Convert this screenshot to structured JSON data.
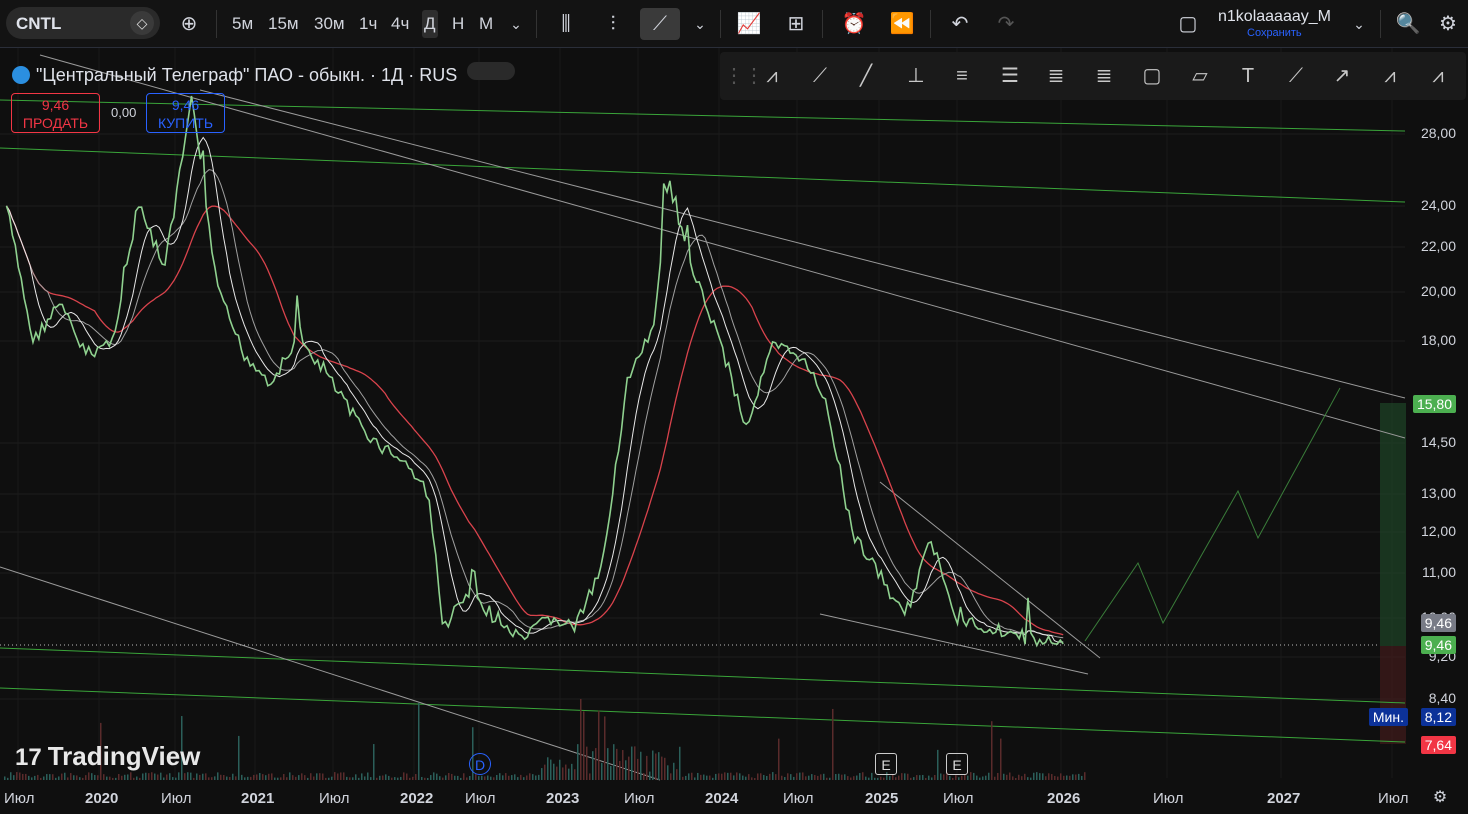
{
  "toolbar": {
    "symbol": "CNTL",
    "timeframes": [
      "5м",
      "15м",
      "30м",
      "1ч",
      "4ч",
      "Д",
      "Н",
      "М"
    ],
    "active_timeframe": "Д",
    "user": "n1kolaaaaay_M",
    "save_label": "Сохранить"
  },
  "legend": {
    "title": "\"Центральный Телеграф\" ПАО - обыкн. · 1Д · RUS"
  },
  "trade": {
    "sell_price": "9,46",
    "sell_label": "ПРОДАТЬ",
    "spread": "0,00",
    "buy_price": "9,46",
    "buy_label": "КУПИТЬ"
  },
  "watermark": "TradingView",
  "price_tags": {
    "target": "15,80",
    "last_gray": "9,46",
    "last_green": "9,46",
    "min_label": "Мин.",
    "min_value": "8,12",
    "stop": "7,64"
  },
  "events": [
    "D",
    "E",
    "E"
  ],
  "colors": {
    "price": "#8fd18f",
    "sma_slow": "#d9434c",
    "sma_fast": "#ffffff",
    "green_line": "#3aa53a",
    "target_zone": "#1f4d2a",
    "stop_zone": "#4a1c1c"
  },
  "chart_data": {
    "type": "line",
    "series": [
      {
        "x": [
          "2019-06",
          "2019-08",
          "2019-10",
          "2019-12",
          "2020-02",
          "2020-04",
          "2020-06",
          "2020-08",
          "2020-10",
          "2020-12",
          "2021-02",
          "2021-04",
          "2021-06",
          "2021-08",
          "2021-10",
          "2021-12",
          "2022-02",
          "2022-03",
          "2022-05",
          "2022-07",
          "2022-09",
          "2022-11",
          "2023-01",
          "2023-03",
          "2023-05",
          "2023-07",
          "2023-08",
          "2023-10",
          "2023-12",
          "2024-02",
          "2024-04",
          "2024-06",
          "2024-08",
          "2024-10",
          "2024-12",
          "2025-02",
          "2025-04",
          "2025-06",
          "2025-08",
          "2025-10",
          "2025-12",
          "2026-02"
        ],
        "values": [
          24.0,
          18.0,
          19.5,
          17.5,
          18.0,
          24.0,
          21.0,
          30.0,
          20.0,
          17.5,
          16.5,
          18.0,
          17.0,
          15.5,
          14.5,
          14.0,
          13.0,
          9.8,
          10.5,
          10.0,
          9.5,
          10.0,
          9.8,
          11.0,
          16.5,
          18.5,
          25.0,
          21.0,
          18.0,
          15.0,
          17.8,
          17.5,
          16.0,
          12.0,
          11.0,
          10.0,
          11.8,
          10.0,
          9.8,
          9.7,
          9.5,
          9.46
        ]
      }
    ],
    "yticks": [
      "28,00",
      "24,00",
      "22,00",
      "20,00",
      "18,00",
      "14,50",
      "13,00",
      "12,00",
      "11,00",
      "10,00",
      "9,20",
      "8,40"
    ],
    "xticks": [
      "Июл",
      "2020",
      "Июл",
      "2021",
      "Июл",
      "2022",
      "Июл",
      "2023",
      "Июл",
      "2024",
      "Июл",
      "2025",
      "Июл",
      "2026",
      "Июл",
      "2027",
      "Июл"
    ],
    "y_scale": "log",
    "last_price": 9.46,
    "target": 15.8,
    "stop": 7.64,
    "min": 8.12
  }
}
